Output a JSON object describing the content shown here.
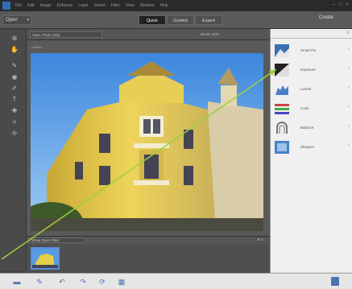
{
  "menubar": {
    "items": [
      "File",
      "Edit",
      "Image",
      "Enhance",
      "Layer",
      "Select",
      "Filter",
      "View",
      "Window",
      "Help"
    ],
    "window_controls": [
      "–",
      "□",
      "×"
    ]
  },
  "modebar": {
    "open_label": "Open",
    "tabs": [
      {
        "label": "Quick",
        "active": true
      },
      {
        "label": "Guided",
        "active": false
      },
      {
        "label": "Expert",
        "active": false
      }
    ],
    "create_label": "Create"
  },
  "optbar": {
    "view_select": "View: Photo Only",
    "zoom": "Zoom: 21%"
  },
  "canvas": {
    "filename": "Untitled"
  },
  "photo_bin": {
    "select_label": "Show Open Files",
    "controls": "▸  ≡"
  },
  "right_panel": {
    "items": [
      {
        "label": "Smart Fix",
        "icon": "smart-fix-icon"
      },
      {
        "label": "Exposure",
        "icon": "exposure-icon"
      },
      {
        "label": "Levels",
        "icon": "levels-icon"
      },
      {
        "label": "Color",
        "icon": "color-icon"
      },
      {
        "label": "Balance",
        "icon": "balance-icon"
      },
      {
        "label": "Sharpen",
        "icon": "sharpen-icon"
      }
    ]
  },
  "colors": {
    "accent": "#2f6fb8",
    "arrow": "#9ad13a",
    "sky": "#6aa9e8",
    "building": "#e3cf4a"
  }
}
